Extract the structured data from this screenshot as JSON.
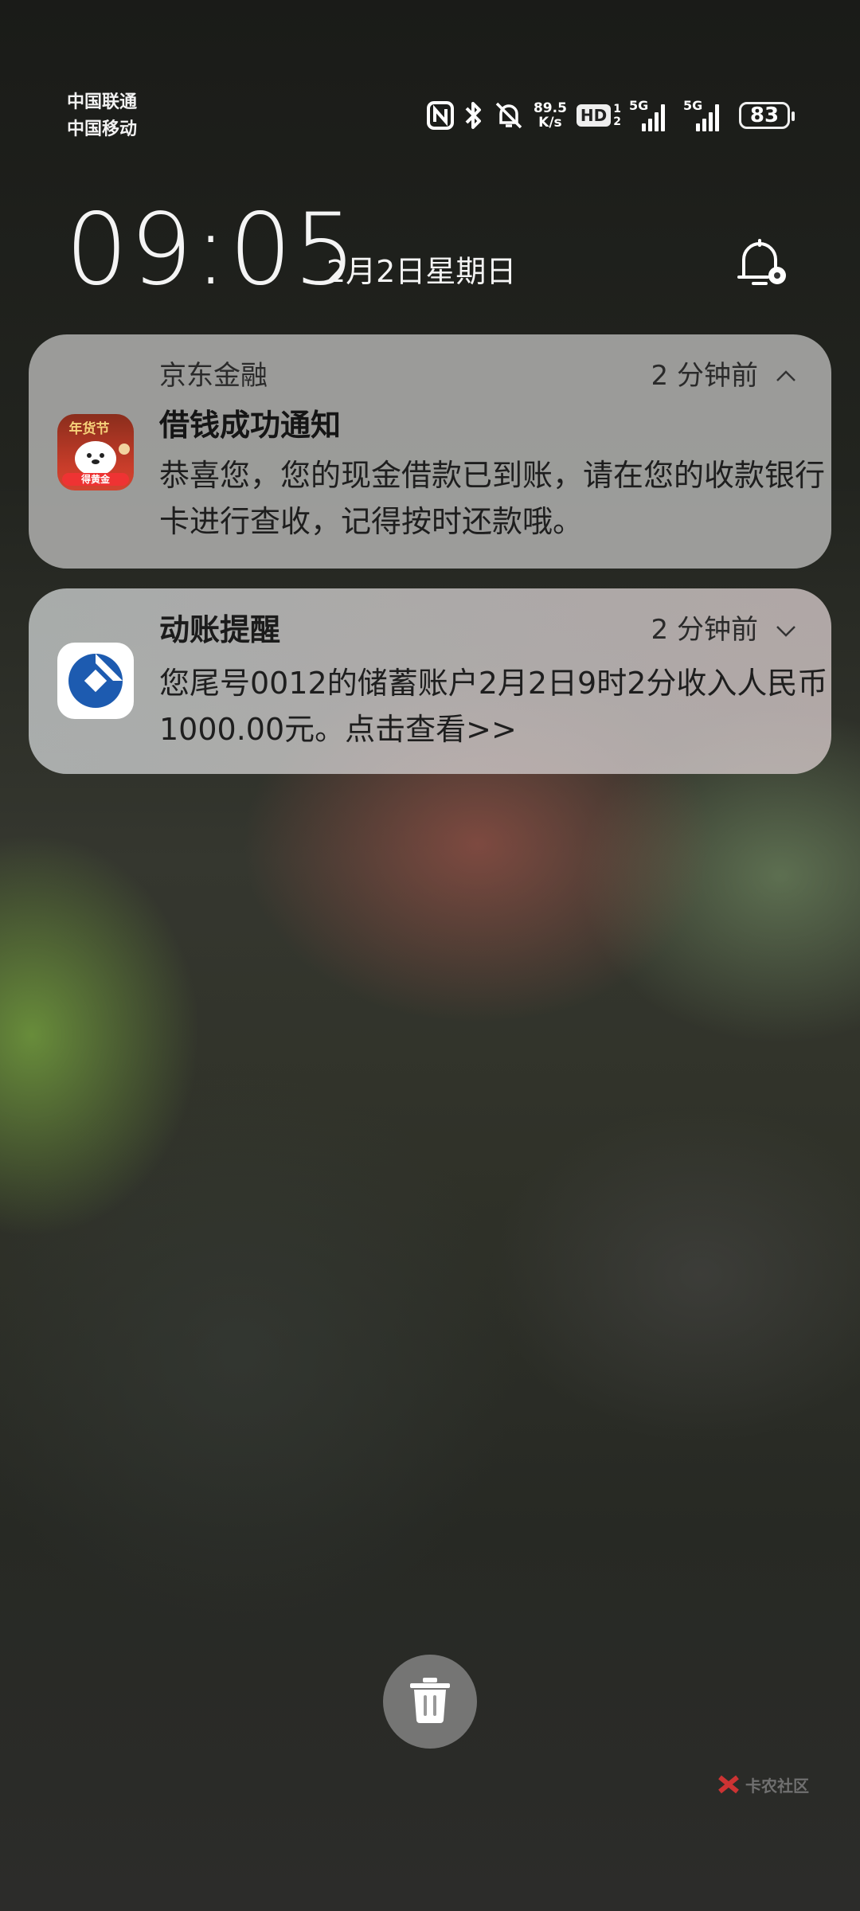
{
  "status_bar": {
    "carrier_1": "中国联通",
    "carrier_2": "中国移动",
    "net_speed_value": "89.5",
    "net_speed_unit": "K/s",
    "hd_label": "HD",
    "sim_1": "1",
    "sim_2": "2",
    "net_1": "5G",
    "net_2": "5G",
    "battery": "83",
    "icons": [
      "nfc-icon",
      "bluetooth-icon",
      "bell-off-icon",
      "signal-icon",
      "battery-icon"
    ]
  },
  "lockscreen": {
    "time": "09:05",
    "date": "2月2日星期日"
  },
  "notifications": [
    {
      "app": "京东金融",
      "time_ago": "2 分钟前",
      "title": "借钱成功通知",
      "body": "恭喜您，您的现金借款已到账，请在您的收款银行卡进行查收，记得按时还款哦。",
      "icon_text_top": "年货节",
      "icon_text_bottom": "得黄金",
      "expanded": true
    },
    {
      "app": "动账提醒",
      "time_ago": "2 分钟前",
      "title": "",
      "body": "您尾号0012的储蓄账户2月2日9时2分收入人民币1000.00元。点击查看>>",
      "expanded": false
    }
  ],
  "watermark": {
    "name": "卡农社区"
  }
}
